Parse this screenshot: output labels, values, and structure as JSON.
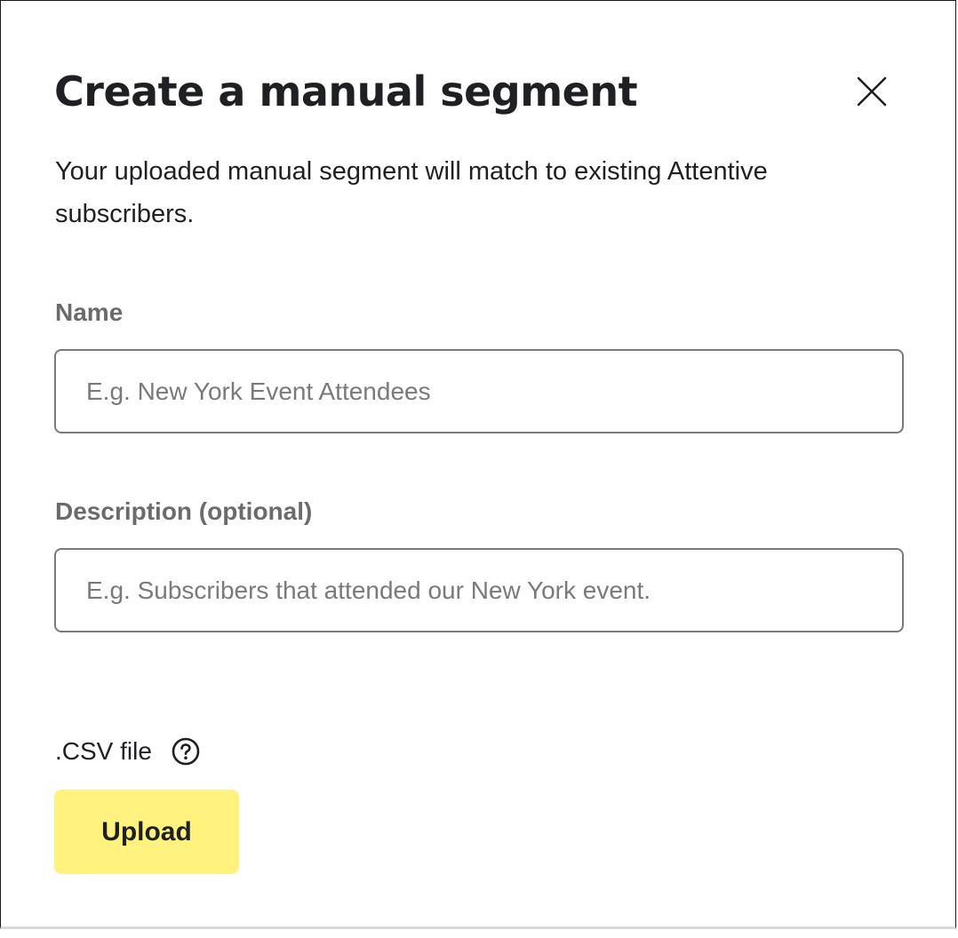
{
  "modal": {
    "title": "Create a manual segment",
    "subtitle": "Your uploaded manual segment will match to existing Attentive subscribers.",
    "close_icon": "close-icon"
  },
  "form": {
    "name": {
      "label": "Name",
      "placeholder": "E.g. New York Event Attendees",
      "value": ""
    },
    "description": {
      "label": "Description (optional)",
      "placeholder": "E.g. Subscribers that attended our New York event.",
      "value": ""
    },
    "csv": {
      "label": ".CSV file",
      "help_icon": "question-circle-icon"
    },
    "upload_label": "Upload"
  },
  "colors": {
    "upload_button": "#fff27e",
    "text": "#1f2023",
    "label": "#6b6b6b",
    "input_border": "#7a7a7a"
  }
}
